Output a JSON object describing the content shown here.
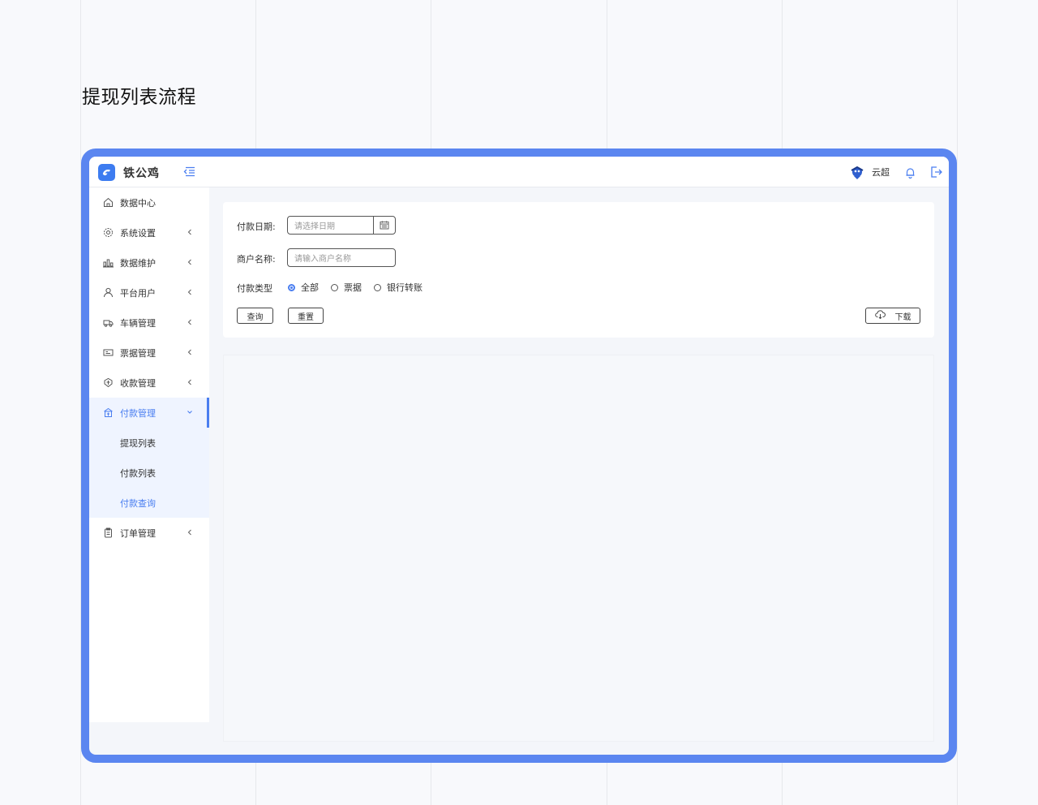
{
  "page_title": "提现列表流程",
  "app": {
    "brand": "铁公鸡",
    "user_name": "云超",
    "accent_color": "#4a7ef0",
    "frame_color": "#5b86f0"
  },
  "sidebar": {
    "items": [
      {
        "label": "数据中心",
        "icon": "home-icon"
      },
      {
        "label": "系统设置",
        "icon": "gear-icon"
      },
      {
        "label": "数据维护",
        "icon": "bar-chart-icon"
      },
      {
        "label": "平台用户",
        "icon": "user-icon"
      },
      {
        "label": "车辆管理",
        "icon": "truck-icon"
      },
      {
        "label": "票据管理",
        "icon": "ticket-icon"
      },
      {
        "label": "收款管理",
        "icon": "receive-money-icon"
      },
      {
        "label": "付款管理",
        "icon": "payment-icon"
      },
      {
        "label": "订单管理",
        "icon": "order-icon"
      }
    ],
    "payment_sub": [
      {
        "label": "提现列表"
      },
      {
        "label": "付款列表"
      },
      {
        "label": "付款查询"
      }
    ]
  },
  "filter": {
    "date_label": "付款日期:",
    "date_placeholder": "请选择日期",
    "merchant_label": "商户名称:",
    "merchant_placeholder": "请输入商户名称",
    "type_label": "付款类型",
    "type_options": [
      "全部",
      "票据",
      "银行转账"
    ],
    "type_selected": "全部",
    "query_button": "查询",
    "reset_button": "重置",
    "download_button": "下载"
  }
}
